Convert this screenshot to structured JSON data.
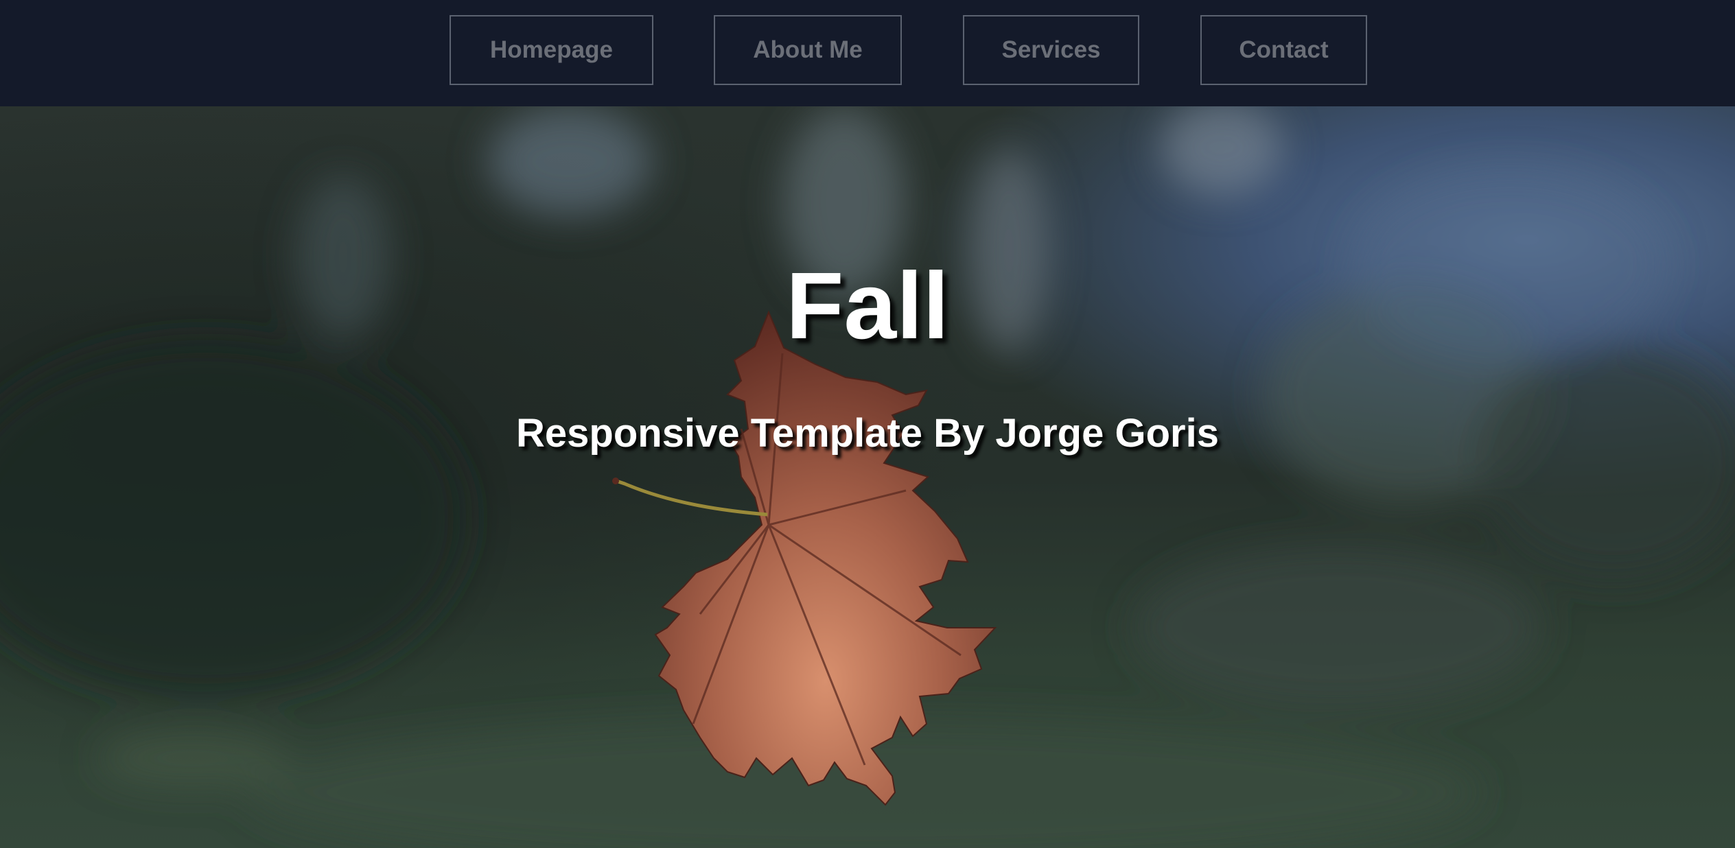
{
  "nav": {
    "items": [
      {
        "label": "Homepage"
      },
      {
        "label": "About Me"
      },
      {
        "label": "Services"
      },
      {
        "label": "Contact"
      }
    ]
  },
  "hero": {
    "title": "Fall",
    "subtitle": "Responsive Template By Jorge Goris"
  },
  "colors": {
    "nav_background": "#141a2a",
    "nav_text": "#6b6f78",
    "nav_border": "#5b6270",
    "hero_text": "#ffffff",
    "leaf": "#a2583d"
  }
}
